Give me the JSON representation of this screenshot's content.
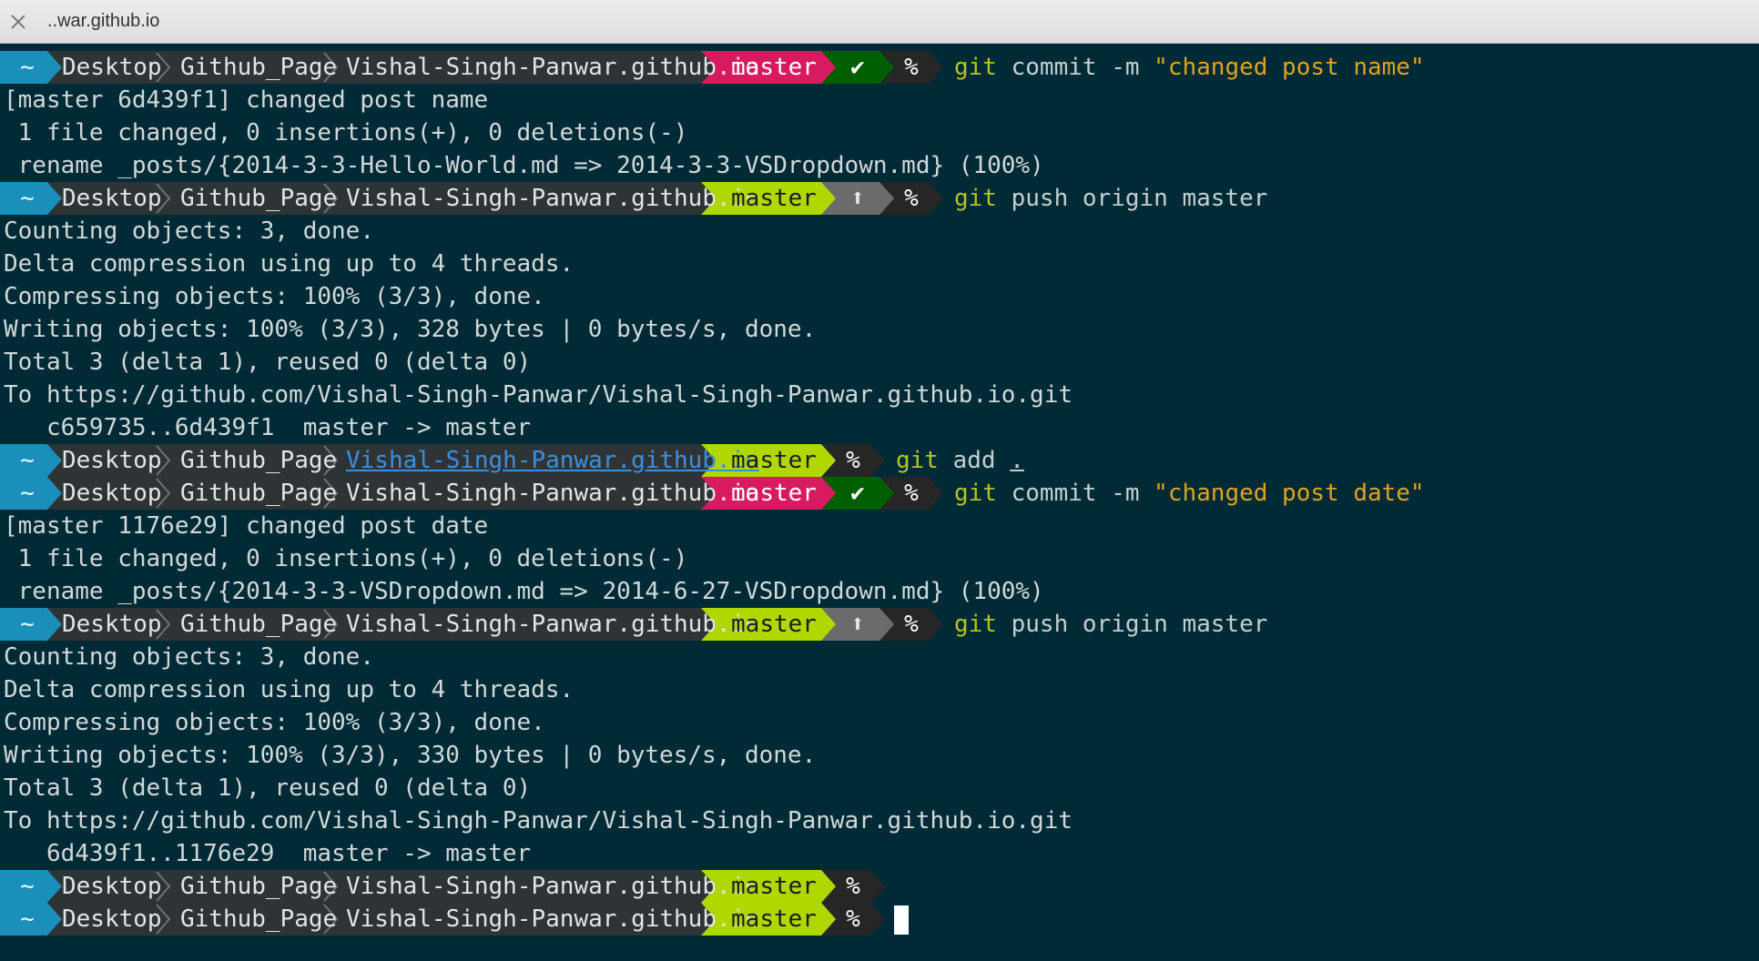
{
  "window": {
    "tab_title": "..war.github.io",
    "close_icon": "close-icon"
  },
  "colors": {
    "background": "#002b36",
    "home_segment": "#1a8fb9",
    "path_segment": "#2e3436",
    "branch_dirty": "#d81b60",
    "branch_clean": "#afd700",
    "status_clean": "#005f00",
    "status_ahead": "#6b6b6b",
    "percent_segment": "#262626"
  },
  "prompt": {
    "home": "~",
    "segments": [
      "Desktop",
      "Github_Page",
      "Vishal-Singh-Panwar.github.io"
    ],
    "branch": "master",
    "symbol": "%",
    "clean_icon": "check-icon",
    "ahead_icon": "up-arrow-icon",
    "clean_glyph": "✔",
    "ahead_glyph": "⬆"
  },
  "lines": [
    {
      "type": "prompt",
      "branch_state": "dirty",
      "status": "clean",
      "cmd": {
        "bin": "git",
        "args": "commit -m ",
        "str": "\"changed post name\""
      }
    },
    {
      "type": "output",
      "text": "[master 6d439f1] changed post name"
    },
    {
      "type": "output",
      "text": " 1 file changed, 0 insertions(+), 0 deletions(-)"
    },
    {
      "type": "output",
      "text": " rename _posts/{2014-3-3-Hello-World.md => 2014-3-3-VSDropdown.md} (100%)"
    },
    {
      "type": "prompt",
      "branch_state": "clean",
      "status": "ahead",
      "cmd": {
        "bin": "git",
        "args": "push origin master"
      }
    },
    {
      "type": "output",
      "text": "Counting objects: 3, done."
    },
    {
      "type": "output",
      "text": "Delta compression using up to 4 threads."
    },
    {
      "type": "output",
      "text": "Compressing objects: 100% (3/3), done."
    },
    {
      "type": "output",
      "text": "Writing objects: 100% (3/3), 328 bytes | 0 bytes/s, done."
    },
    {
      "type": "output",
      "text": "Total 3 (delta 1), reused 0 (delta 0)"
    },
    {
      "type": "output",
      "text": "To https://github.com/Vishal-Singh-Panwar/Vishal-Singh-Panwar.github.io.git"
    },
    {
      "type": "output",
      "text": "   c659735..6d439f1  master -> master"
    },
    {
      "type": "prompt",
      "branch_state": "clean",
      "status": "none",
      "link": true,
      "cmd": {
        "bin": "git",
        "args": "add ",
        "dot": "."
      }
    },
    {
      "type": "prompt",
      "branch_state": "dirty",
      "status": "clean",
      "cmd": {
        "bin": "git",
        "args": "commit -m ",
        "str": "\"changed post date\""
      }
    },
    {
      "type": "output",
      "text": "[master 1176e29] changed post date"
    },
    {
      "type": "output",
      "text": " 1 file changed, 0 insertions(+), 0 deletions(-)"
    },
    {
      "type": "output",
      "text": " rename _posts/{2014-3-3-VSDropdown.md => 2014-6-27-VSDropdown.md} (100%)"
    },
    {
      "type": "prompt",
      "branch_state": "clean",
      "status": "ahead",
      "cmd": {
        "bin": "git",
        "args": "push origin master"
      }
    },
    {
      "type": "output",
      "text": "Counting objects: 3, done."
    },
    {
      "type": "output",
      "text": "Delta compression using up to 4 threads."
    },
    {
      "type": "output",
      "text": "Compressing objects: 100% (3/3), done."
    },
    {
      "type": "output",
      "text": "Writing objects: 100% (3/3), 330 bytes | 0 bytes/s, done."
    },
    {
      "type": "output",
      "text": "Total 3 (delta 1), reused 0 (delta 0)"
    },
    {
      "type": "output",
      "text": "To https://github.com/Vishal-Singh-Panwar/Vishal-Singh-Panwar.github.io.git"
    },
    {
      "type": "output",
      "text": "   6d439f1..1176e29  master -> master"
    },
    {
      "type": "prompt",
      "branch_state": "clean",
      "status": "none"
    },
    {
      "type": "prompt",
      "branch_state": "clean",
      "status": "none",
      "cursor": true
    }
  ]
}
